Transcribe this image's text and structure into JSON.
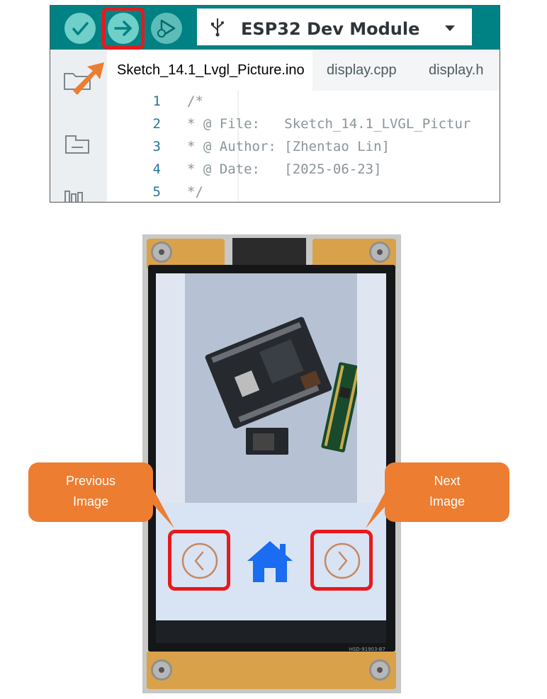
{
  "ide": {
    "toolbar": {
      "verify_icon": "check-icon",
      "upload_icon": "arrow-right-icon",
      "debug_icon": "debug-play-icon",
      "board": "ESP32 Dev Module",
      "board_icon": "usb-icon"
    },
    "tabs": [
      {
        "label": "Sketch_14.1_Lvgl_Picture.ino"
      },
      {
        "label": "display.cpp"
      },
      {
        "label": "display.h"
      }
    ],
    "code": [
      {
        "n": "1",
        "text": "/*"
      },
      {
        "n": "2",
        "text": "* @ File:   Sketch_14.1_LVGL_Pictur"
      },
      {
        "n": "3",
        "text": "* @ Author: [Zhentao Lin]"
      },
      {
        "n": "4",
        "text": "* @ Date:   [2025-06-23]"
      },
      {
        "n": "5",
        "text": "*/"
      }
    ],
    "accent_color": "#008184",
    "highlight_color": "#e8191d"
  },
  "device": {
    "panel_label": "HSD-91903-B7",
    "nav": {
      "prev_icon": "chevron-left-icon",
      "home_icon": "home-icon",
      "next_icon": "chevron-right-icon"
    }
  },
  "callouts": {
    "previous": {
      "line1": "Previous",
      "line2": "Image"
    },
    "next": {
      "line1": "Next",
      "line2": "Image"
    },
    "color": "#ed7d31"
  }
}
